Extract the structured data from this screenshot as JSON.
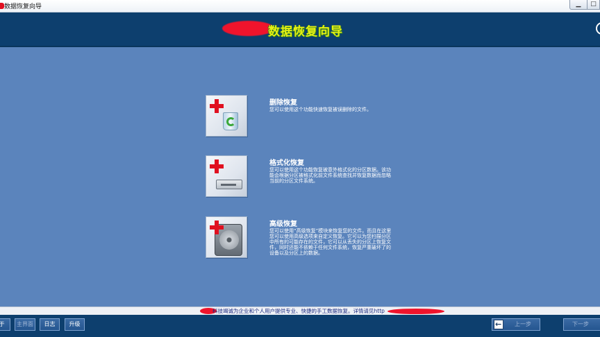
{
  "window": {
    "title": "数据恢复向导",
    "minimize_glyph": "▁",
    "maximize_glyph": "□"
  },
  "header": {
    "title": "数据恢复向导",
    "title_color": "#e6f014",
    "background": "#0d3f6e"
  },
  "options": [
    {
      "id": "delete-recovery",
      "icon": "recycle-bin-icon",
      "title": "删除恢复",
      "desc": "您可以使用这个功能快速恢复被误删除的文件。"
    },
    {
      "id": "format-recovery",
      "icon": "drive-icon",
      "title": "格式化恢复",
      "desc": "您可以使用这个功能恢复被意外格式化的分区数据。该功能会根据分区被格式化前文件系统查找并恢复数据而忽略当前的分区文件系统。"
    },
    {
      "id": "advanced-recovery",
      "icon": "hard-disk-icon",
      "title": "高级恢复",
      "desc": "您可以使用“高级恢复”模块来恢复您的文件。而且在这里您可以使用高级选项来自定义恢复。它可以为您扫描分区中所有的可能存在的文件，它可以从丢失的分区上恢复文件，同时还能不依赖于任何文件系统，恢复严重破坏了的设备以及分区上的数据。"
    }
  ],
  "status": {
    "text": "科技竭诚为企业和个人用户提供专业、快捷的手工数据恢复。详情请见http"
  },
  "toolbar": {
    "about_label": "于",
    "home_label": "主界面",
    "log_label": "日志",
    "upgrade_label": "升级",
    "prev_label": "上一步",
    "next_label": "下一步"
  },
  "colors": {
    "background": "#5b84bc",
    "accent_red": "#e01020",
    "status_text": "#1a2a80"
  }
}
